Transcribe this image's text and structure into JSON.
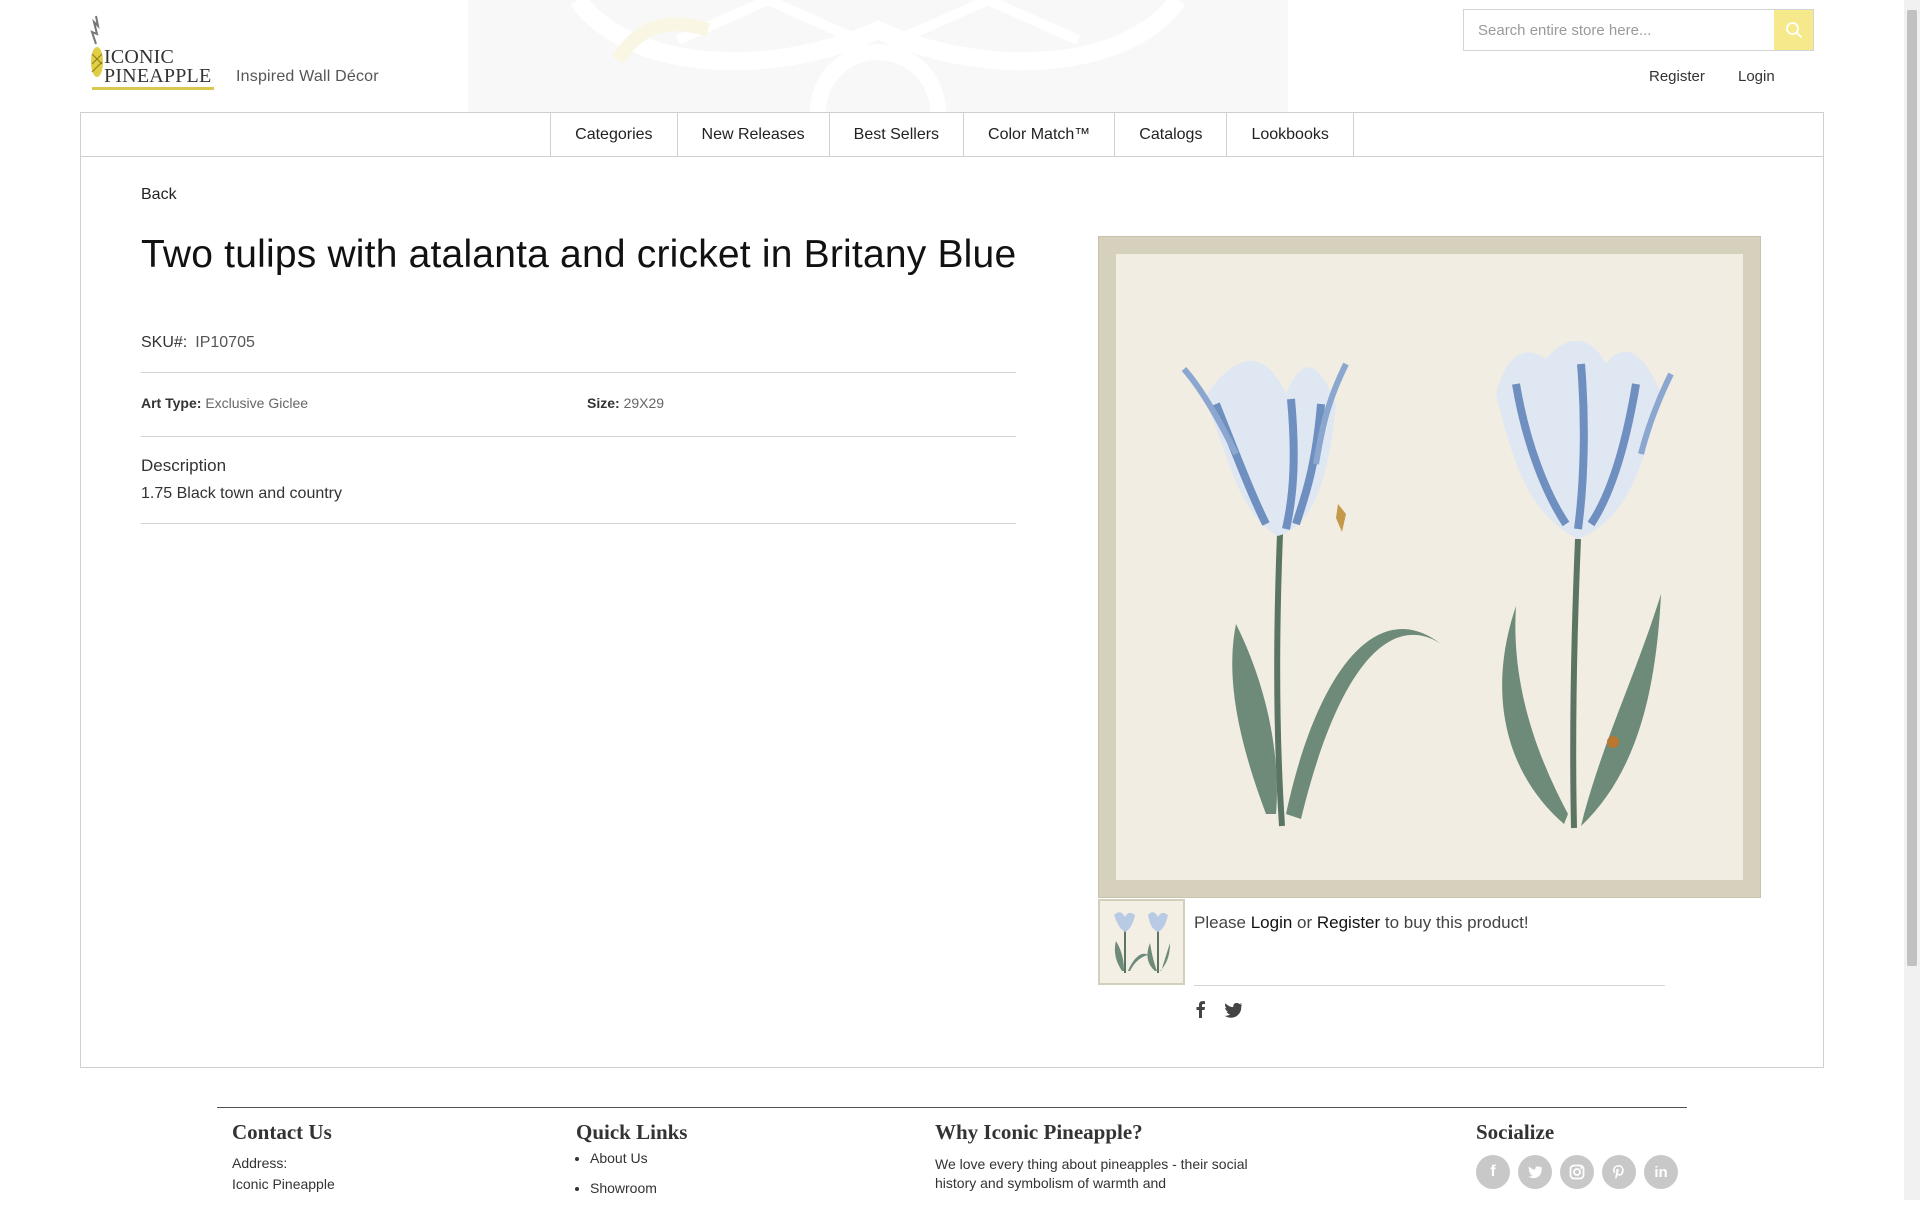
{
  "header": {
    "logo_line1": "ICONIC",
    "logo_line2": "PINEAPPLE",
    "tagline": "Inspired Wall Décor",
    "search_placeholder": "Search entire store here...",
    "register": "Register",
    "login": "Login",
    "accent_color": "#f5e98b"
  },
  "nav": {
    "items": [
      {
        "label": "Categories"
      },
      {
        "label": "New Releases"
      },
      {
        "label": "Best Sellers"
      },
      {
        "label": "Color Match™"
      },
      {
        "label": "Catalogs"
      },
      {
        "label": "Lookbooks"
      }
    ]
  },
  "product": {
    "back": "Back",
    "title": "Two tulips with atalanta and cricket in Britany Blue",
    "sku_label": "SKU#:",
    "sku": "IP10705",
    "art_type_label": "Art Type:",
    "art_type": "Exclusive Giclee",
    "size_label": "Size:",
    "size": "29X29",
    "description_heading": "Description",
    "description": "1.75 Black town and country",
    "buy_prefix": "Please ",
    "buy_login": "Login",
    "buy_or": " or ",
    "buy_register": "Register",
    "buy_suffix": " to buy this product!"
  },
  "footer": {
    "contact_heading": "Contact Us",
    "address_label": "Address:",
    "address_line1": "Iconic Pineapple",
    "quick_links_heading": "Quick Links",
    "quick_links": [
      {
        "label": "About Us"
      },
      {
        "label": "Showroom"
      }
    ],
    "why_heading": "Why Iconic Pineapple?",
    "why_text": "We love every thing about pineapples - their social history and symbolism of warmth and",
    "socialize_heading": "Socialize",
    "social_icons": [
      "facebook-icon",
      "twitter-icon",
      "instagram-icon",
      "pinterest-icon",
      "linkedin-icon"
    ]
  }
}
